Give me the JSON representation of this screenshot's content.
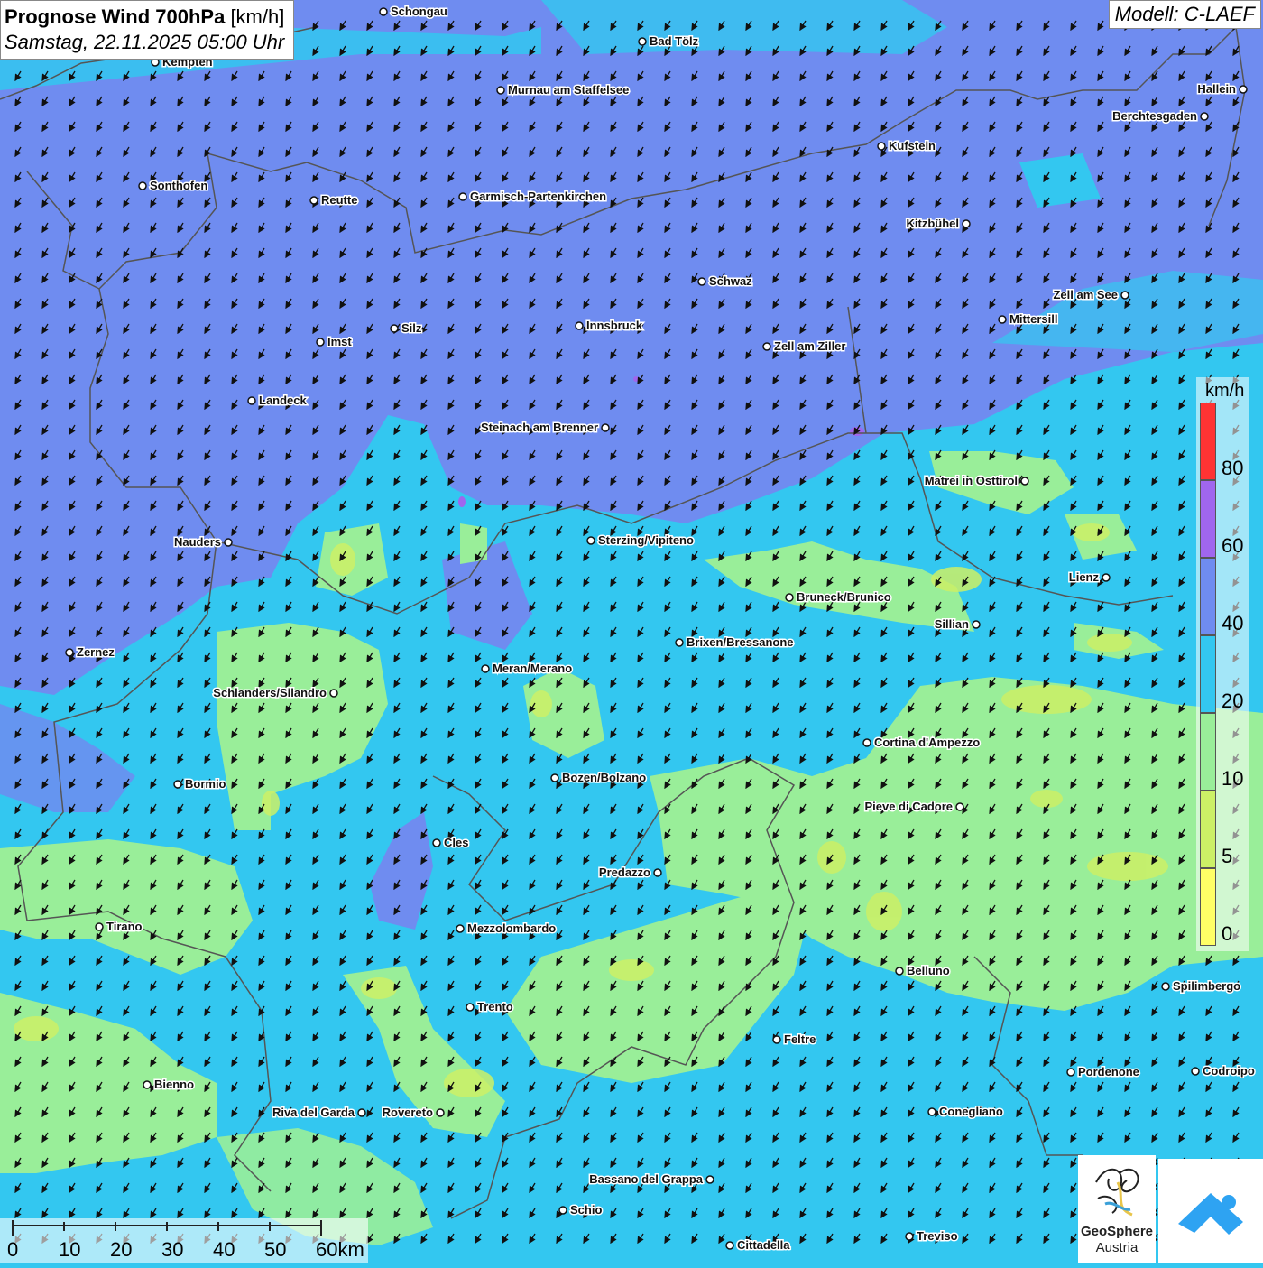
{
  "header": {
    "title": "Prognose Wind 700hPa",
    "unit": "[km/h]",
    "datetime": "Samstag, 22.11.2025 05:00 Uhr",
    "model": "Modell: C-LAEF"
  },
  "legend": {
    "unit": "km/h",
    "labels": [
      "80",
      "60",
      "40",
      "20",
      "10",
      "5",
      "0"
    ],
    "colors": [
      "#ff3333",
      "#a066ee",
      "#6f8cf0",
      "#33c7f0",
      "#99ee99",
      "#ccf066",
      "#ffff66"
    ]
  },
  "scalebar": {
    "labels": [
      "0",
      "10",
      "20",
      "30",
      "40",
      "50",
      "60km"
    ]
  },
  "logos": {
    "geosphere_line1": "GeoSphere",
    "geosphere_line2": "Austria"
  },
  "wind_direction": "north-northeast",
  "cities": [
    {
      "name": "Schongau"
    },
    {
      "name": "Bad Tölz"
    },
    {
      "name": "Kempten"
    },
    {
      "name": "Murnau am Staffelsee"
    },
    {
      "name": "Hallein"
    },
    {
      "name": "Berchtesgaden"
    },
    {
      "name": "Kufstein"
    },
    {
      "name": "Sonthofen"
    },
    {
      "name": "Reutte"
    },
    {
      "name": "Garmisch-Partenkirchen"
    },
    {
      "name": "Kitzbühel"
    },
    {
      "name": "Schwaz"
    },
    {
      "name": "Zell am See"
    },
    {
      "name": "Mittersill"
    },
    {
      "name": "Imst"
    },
    {
      "name": "Silz"
    },
    {
      "name": "Innsbruck"
    },
    {
      "name": "Zell am Ziller"
    },
    {
      "name": "Landeck"
    },
    {
      "name": "Steinach am Brenner"
    },
    {
      "name": "Matrei in Osttirol"
    },
    {
      "name": "Nauders"
    },
    {
      "name": "Sterzing/Vipiteno"
    },
    {
      "name": "Lienz"
    },
    {
      "name": "Bruneck/Brunico"
    },
    {
      "name": "Sillian"
    },
    {
      "name": "Brixen/Bressanone"
    },
    {
      "name": "Zernez"
    },
    {
      "name": "Meran/Merano"
    },
    {
      "name": "Schlanders/Silandro"
    },
    {
      "name": "Cortina d'Ampezzo"
    },
    {
      "name": "Bormio"
    },
    {
      "name": "Bozen/Bolzano"
    },
    {
      "name": "Pieve di Cadore"
    },
    {
      "name": "Cles"
    },
    {
      "name": "Predazzo"
    },
    {
      "name": "Tirano"
    },
    {
      "name": "Mezzolombardo"
    },
    {
      "name": "Belluno"
    },
    {
      "name": "Spilimbergo"
    },
    {
      "name": "Trento"
    },
    {
      "name": "Feltre"
    },
    {
      "name": "Pordenone"
    },
    {
      "name": "Codroipo"
    },
    {
      "name": "Bienno"
    },
    {
      "name": "Riva del Garda"
    },
    {
      "name": "Rovereto"
    },
    {
      "name": "Conegliano"
    },
    {
      "name": "Bassano del Grappa"
    },
    {
      "name": "Schio"
    },
    {
      "name": "Treviso"
    },
    {
      "name": "Cittadella"
    }
  ]
}
